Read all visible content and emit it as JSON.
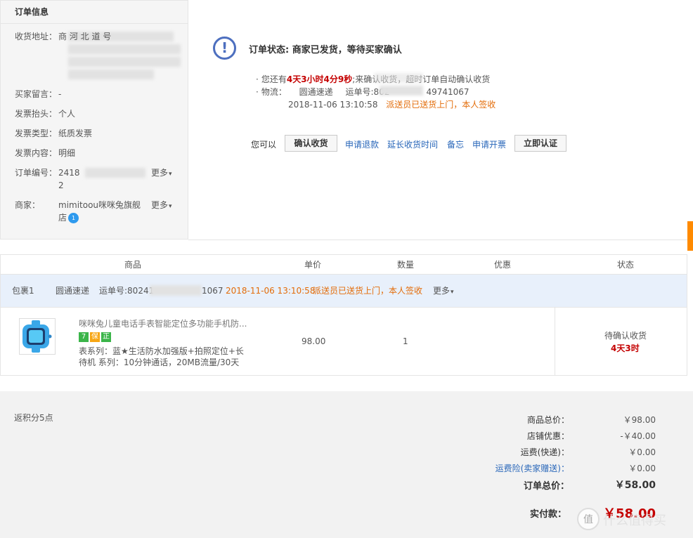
{
  "info": {
    "title": "订单信息",
    "rows": [
      {
        "label": "收货地址：",
        "value": "商 河 北 道 号"
      },
      {
        "label": "买家留言：",
        "value": "-"
      },
      {
        "label": "发票抬头：",
        "value": "个人"
      },
      {
        "label": "发票类型：",
        "value": "纸质发票"
      },
      {
        "label": "发票内容：",
        "value": "明细"
      },
      {
        "label": "订单编号：",
        "value": "2418",
        "value2": "2",
        "more": "更多"
      },
      {
        "label": "商家：",
        "value": "mimitoou咪咪兔旗舰",
        "value2": "店",
        "more": "更多",
        "badge": "1"
      }
    ]
  },
  "status": {
    "title": "订单状态: 商家已发货，等待买家确认",
    "line1_prefix": "您还有",
    "line1_time": "4天3小时4分9秒",
    "line1_suffix": "来确认收货，超时订单自动确认收货",
    "line2_label": "物流：",
    "line2_carrier": "圆通速递",
    "line2_waybill": "运单号:802",
    "line2_waybill_tail": "49741067",
    "line3_time": "2018-11-06 13:10:58",
    "line3_msg": "派送员已送货上门，本人签收"
  },
  "actions": {
    "prefix": "您可以",
    "confirm": "确认收货",
    "refund": "申请退款",
    "extend": "延长收货时间",
    "memo": "备忘",
    "invoice": "申请开票",
    "certify": "立即认证"
  },
  "table": {
    "headers": [
      "商品",
      "单价",
      "数量",
      "优惠",
      "状态"
    ],
    "package": {
      "name": "包裹1",
      "carrier": "圆通速递",
      "waybill": "运单号:80241",
      "waybill_tail": "1067",
      "time": "2018-11-06 13:10:58",
      "msg": "派送员已送货上门，本人签收",
      "more": "更多"
    },
    "item": {
      "title": "咪咪兔儿童电话手表智能定位多功能手机防...",
      "tags": [
        "7",
        "保",
        "正"
      ],
      "spec1": "表系列：蓝★生活防水加强版+拍照定位+长",
      "spec2": "待机 系列：10分钟通话，20MB流量/30天",
      "price": "98.00",
      "qty": "1",
      "status": "待确认收货",
      "countdown": "4天3时"
    }
  },
  "summary": {
    "points": "返积分5点",
    "rows": [
      {
        "label": "商品总价：",
        "value": "￥98.00"
      },
      {
        "label": "店铺优惠：",
        "value": "-￥40.00"
      },
      {
        "label": "运费(快递)：",
        "value": "￥0.00"
      },
      {
        "label": "运费险(卖家赠送)：",
        "value": "￥0.00"
      }
    ],
    "total_label": "订单总价：",
    "total_value": "￥58.00",
    "paid_label": "实付款：",
    "paid_value": "￥58.00"
  },
  "watermark": "值 什么值得买",
  "colors": {
    "red": "#c40000",
    "orange": "#e36c09",
    "link": "#2866b9",
    "highlight_row": "#e8f0fb"
  }
}
